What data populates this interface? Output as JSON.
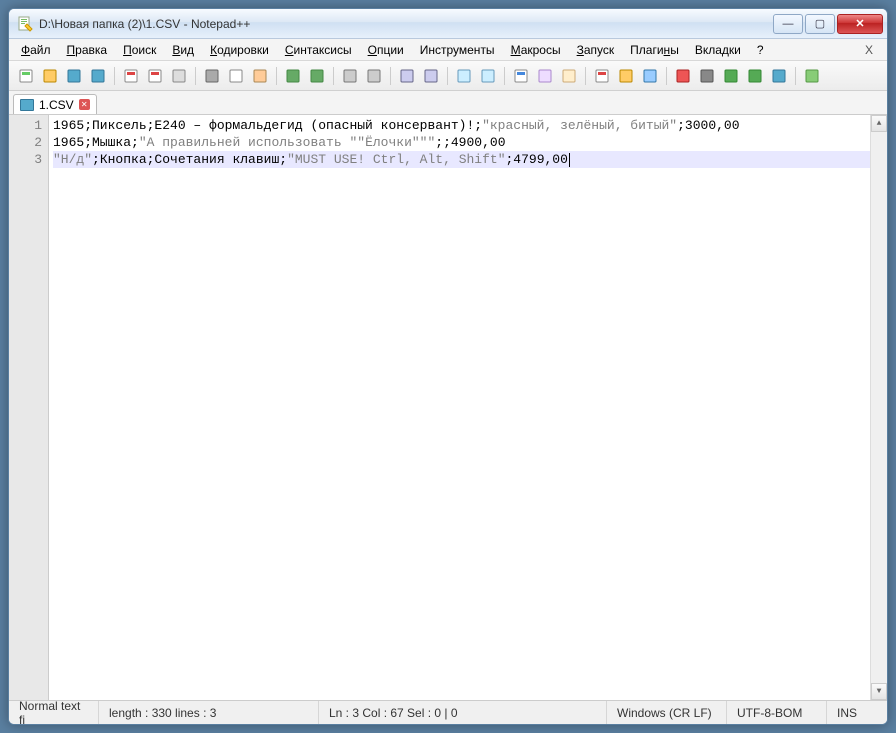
{
  "window": {
    "title": "D:\\Новая папка (2)\\1.CSV - Notepad++"
  },
  "menu": {
    "items": [
      {
        "label": "Файл",
        "u": 0
      },
      {
        "label": "Правка",
        "u": 0
      },
      {
        "label": "Поиск",
        "u": 0
      },
      {
        "label": "Вид",
        "u": 0
      },
      {
        "label": "Кодировки",
        "u": 0
      },
      {
        "label": "Синтаксисы",
        "u": 0
      },
      {
        "label": "Опции",
        "u": 0
      },
      {
        "label": "Инструменты",
        "u": -1
      },
      {
        "label": "Макросы",
        "u": 0
      },
      {
        "label": "Запуск",
        "u": 0
      },
      {
        "label": "Плагины",
        "u": 5
      },
      {
        "label": "Вкладки",
        "u": -1
      },
      {
        "label": "?",
        "u": -1
      }
    ],
    "close_x": "X"
  },
  "toolbar": {
    "icons": [
      {
        "name": "new-file-icon",
        "fill": "#fff",
        "stroke": "#888",
        "accent": "#6c6"
      },
      {
        "name": "open-file-icon",
        "fill": "#fc6",
        "stroke": "#b80"
      },
      {
        "name": "save-icon",
        "fill": "#5ac",
        "stroke": "#379"
      },
      {
        "name": "save-all-icon",
        "fill": "#5ac",
        "stroke": "#379"
      },
      {
        "name": "sep"
      },
      {
        "name": "close-file-icon",
        "fill": "#fff",
        "stroke": "#888",
        "accent": "#d44"
      },
      {
        "name": "close-all-icon",
        "fill": "#fff",
        "stroke": "#888",
        "accent": "#d44"
      },
      {
        "name": "print-icon",
        "fill": "#ddd",
        "stroke": "#888"
      },
      {
        "name": "sep"
      },
      {
        "name": "cut-icon",
        "fill": "#aaa",
        "stroke": "#666"
      },
      {
        "name": "copy-icon",
        "fill": "#fff",
        "stroke": "#888"
      },
      {
        "name": "paste-icon",
        "fill": "#fc9",
        "stroke": "#a85"
      },
      {
        "name": "sep"
      },
      {
        "name": "undo-icon",
        "fill": "#6a6",
        "stroke": "#484"
      },
      {
        "name": "redo-icon",
        "fill": "#6a6",
        "stroke": "#484"
      },
      {
        "name": "sep"
      },
      {
        "name": "find-icon",
        "fill": "#ccc",
        "stroke": "#777"
      },
      {
        "name": "replace-icon",
        "fill": "#ccc",
        "stroke": "#777"
      },
      {
        "name": "sep"
      },
      {
        "name": "zoom-in-icon",
        "fill": "#cce",
        "stroke": "#668"
      },
      {
        "name": "zoom-out-icon",
        "fill": "#cce",
        "stroke": "#668"
      },
      {
        "name": "sep"
      },
      {
        "name": "sync-v-icon",
        "fill": "#cef",
        "stroke": "#69b"
      },
      {
        "name": "sync-h-icon",
        "fill": "#cef",
        "stroke": "#69b"
      },
      {
        "name": "sep"
      },
      {
        "name": "wordwrap-icon",
        "fill": "#fff",
        "stroke": "#888",
        "accent": "#48d"
      },
      {
        "name": "allchars-icon",
        "fill": "#edf",
        "stroke": "#a8c"
      },
      {
        "name": "indent-guide-icon",
        "fill": "#fec",
        "stroke": "#ca7"
      },
      {
        "name": "sep"
      },
      {
        "name": "lang-icon",
        "fill": "#fff",
        "stroke": "#888",
        "accent": "#d44"
      },
      {
        "name": "folder-icon",
        "fill": "#fc6",
        "stroke": "#b80"
      },
      {
        "name": "monitor-icon",
        "fill": "#9cf",
        "stroke": "#37a"
      },
      {
        "name": "sep"
      },
      {
        "name": "record-macro-icon",
        "fill": "#e55",
        "stroke": "#a22"
      },
      {
        "name": "stop-macro-icon",
        "fill": "#888",
        "stroke": "#555"
      },
      {
        "name": "play-macro-icon",
        "fill": "#5a5",
        "stroke": "#383"
      },
      {
        "name": "fast-macro-icon",
        "fill": "#5a5",
        "stroke": "#383"
      },
      {
        "name": "save-macro-icon",
        "fill": "#5ac",
        "stroke": "#379"
      },
      {
        "name": "sep"
      },
      {
        "name": "plugin-icon",
        "fill": "#8c7",
        "stroke": "#594"
      }
    ]
  },
  "tabs": {
    "active": {
      "label": "1.CSV"
    }
  },
  "editor": {
    "lines": [
      {
        "plain": "1965;Пиксель;E240 – формальдегид (опасный консервант)!;",
        "quoted": "\"красный, зелёный, битый\"",
        "tail": ";3000,00"
      },
      {
        "plain": "1965;Мышка;",
        "quoted": "\"А правильней использовать \"\"Ёлочки\"\"\"",
        "tail": ";;4900,00"
      },
      {
        "plain": "",
        "quoted": "\"Н/д\"",
        "mid": ";Кнопка;Сочетания клавиш;",
        "quoted2": "\"MUST USE! Ctrl, Alt, Shift\"",
        "tail": ";4799,00"
      }
    ]
  },
  "status": {
    "filetype": "Normal text fi",
    "length": "length : 330    lines : 3",
    "pos": "Ln : 3    Col : 67    Sel : 0 | 0",
    "eol": "Windows (CR LF)",
    "encoding": "UTF-8-BOM",
    "mode": "INS"
  }
}
